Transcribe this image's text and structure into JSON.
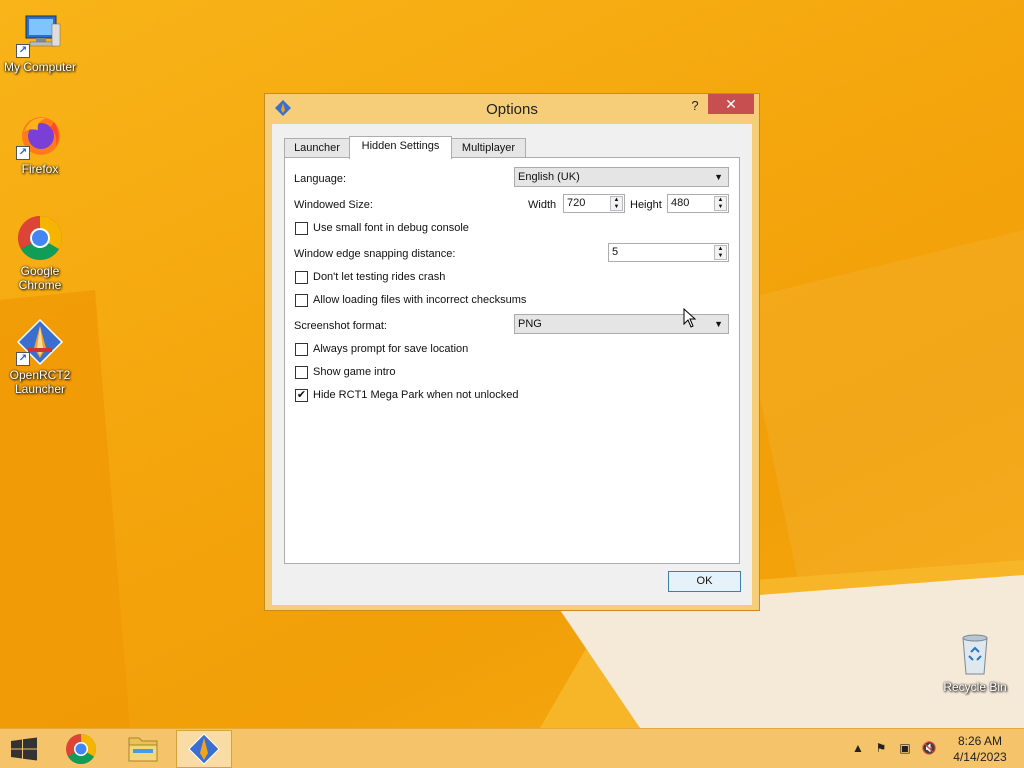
{
  "desktop": {
    "icons": [
      {
        "label": "My Computer",
        "icon": "computer-icon"
      },
      {
        "label": "Firefox",
        "icon": "firefox-icon"
      },
      {
        "label": "Google Chrome",
        "icon": "chrome-icon"
      },
      {
        "label": "OpenRCT2 Launcher",
        "icon": "openrct2-icon"
      },
      {
        "label": "Recycle Bin",
        "icon": "recycle-bin-icon"
      }
    ]
  },
  "dialog": {
    "title": "Options",
    "help_label": "?",
    "close_label": "✕",
    "tabs": [
      {
        "label": "Launcher"
      },
      {
        "label": "Hidden Settings",
        "active": true
      },
      {
        "label": "Multiplayer"
      }
    ],
    "settings": {
      "language_label": "Language:",
      "language_value": "English (UK)",
      "windowed_size_label": "Windowed Size:",
      "width_label": "Width",
      "width_value": "720",
      "height_label": "Height",
      "height_value": "480",
      "small_font_label": "Use small font in debug console",
      "small_font_checked": false,
      "snap_label": "Window edge snapping distance:",
      "snap_value": "5",
      "no_crash_label": "Don't let testing rides crash",
      "no_crash_checked": false,
      "checksum_label": "Allow loading files with incorrect checksums",
      "checksum_checked": false,
      "screenshot_label": "Screenshot format:",
      "screenshot_value": "PNG",
      "save_prompt_label": "Always prompt for save location",
      "save_prompt_checked": false,
      "game_intro_label": "Show game intro",
      "game_intro_checked": false,
      "mega_park_label": "Hide RCT1 Mega Park when not unlocked",
      "mega_park_checked": true,
      "check_mark": "✔"
    },
    "ok_label": "OK"
  },
  "taskbar": {
    "clock_time": "8:26 AM",
    "clock_date": "4/14/2023",
    "colors": {
      "bar": "#f4c36a",
      "active_task": "#f9dca5"
    }
  }
}
